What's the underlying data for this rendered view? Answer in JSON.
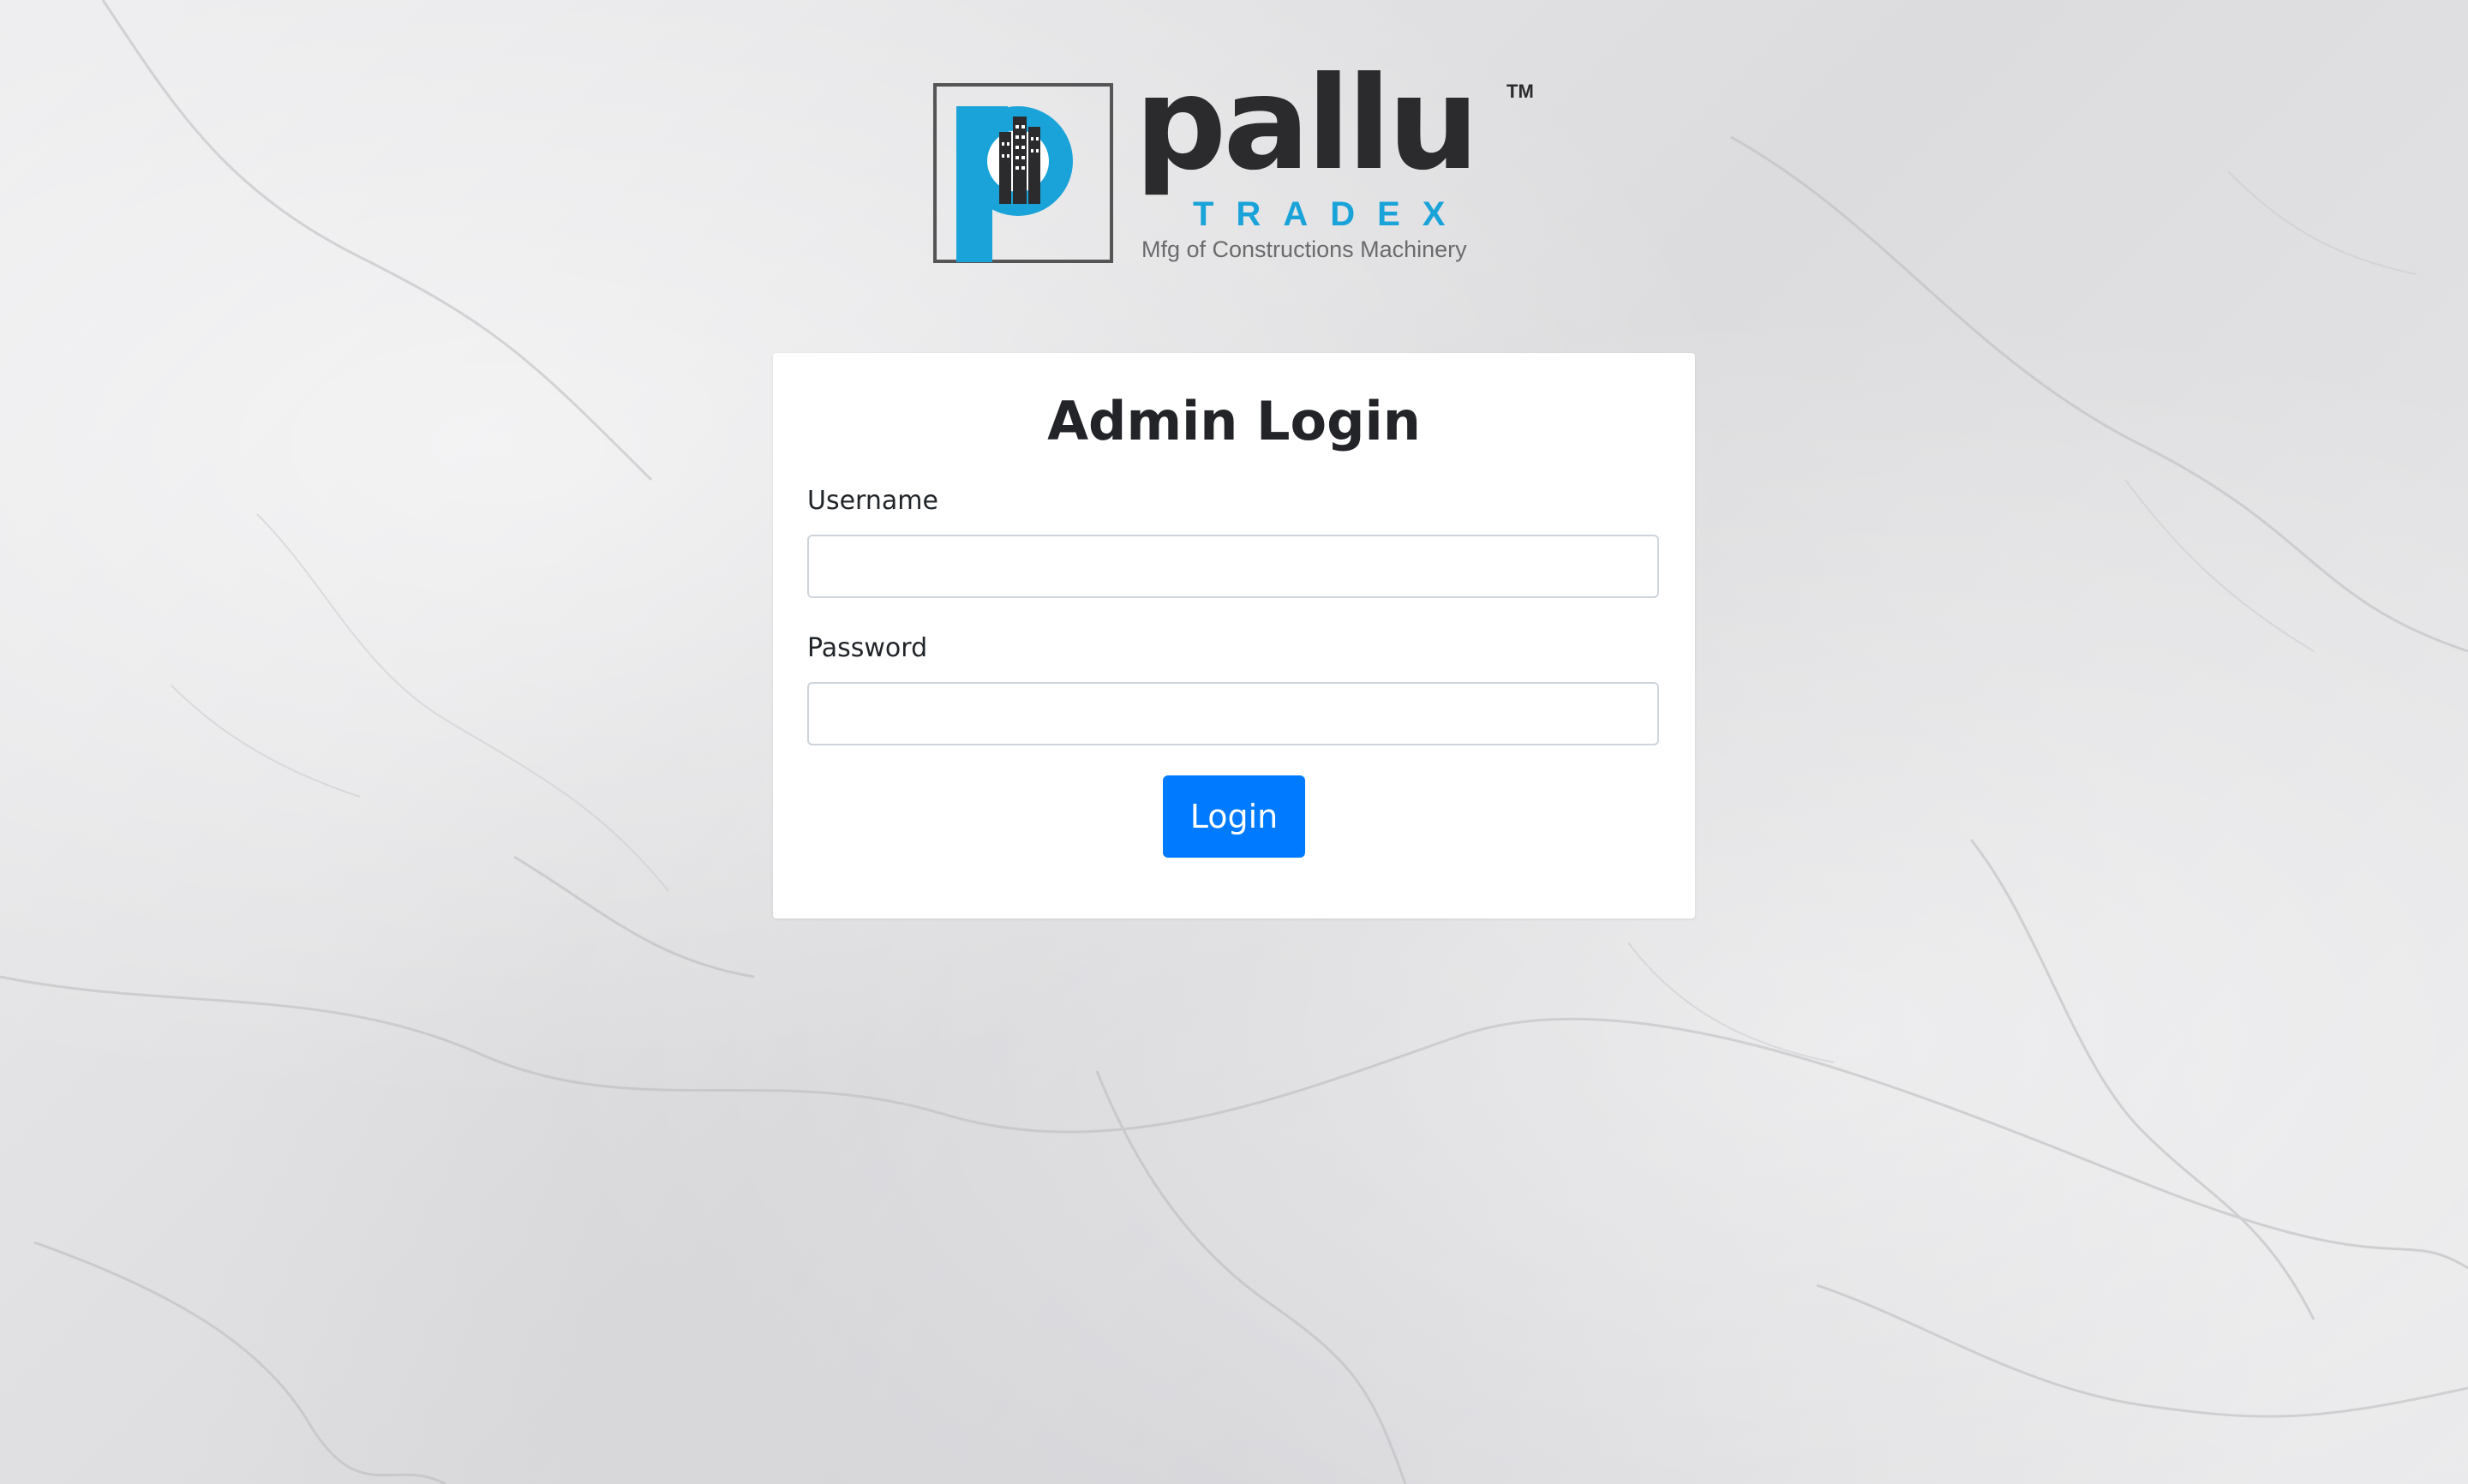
{
  "brand": {
    "name": "pallu",
    "trademark": "TM",
    "subname": "TRADEX",
    "tagline": "Mfg of Constructions Machinery",
    "accent_color": "#1aa3d9",
    "dark_color": "#2b2b2d"
  },
  "login": {
    "title": "Admin Login",
    "username_label": "Username",
    "username_value": "",
    "password_label": "Password",
    "password_value": "",
    "button_label": "Login",
    "button_color": "#007bff"
  }
}
